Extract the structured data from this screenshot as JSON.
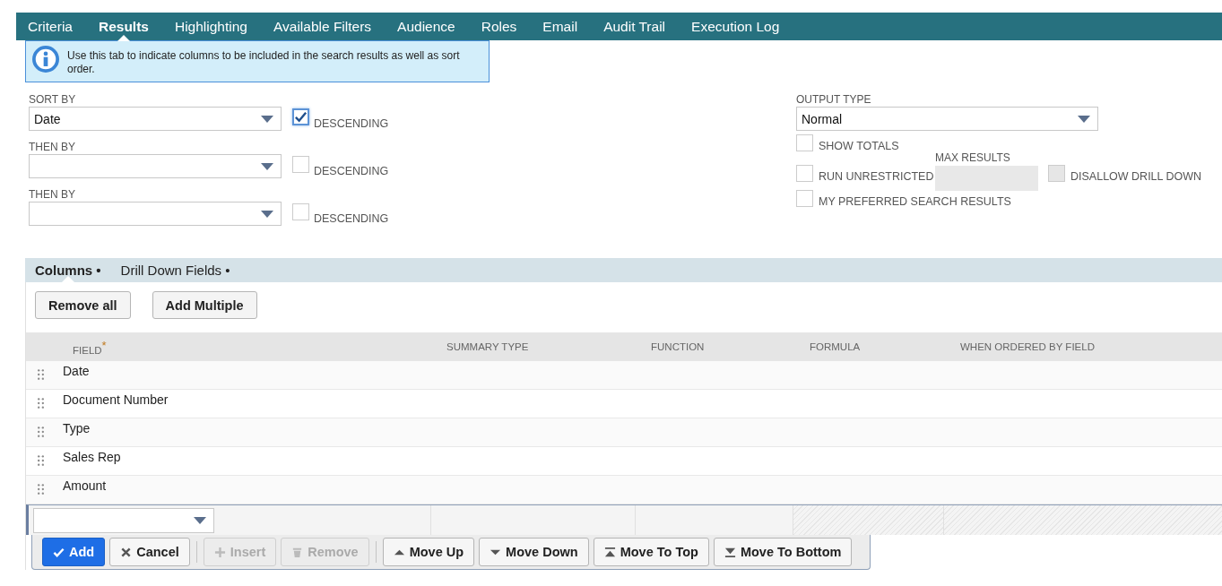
{
  "tabs": [
    {
      "label": "Criteria",
      "selected": false
    },
    {
      "label": "Results",
      "selected": true
    },
    {
      "label": "Highlighting",
      "selected": false
    },
    {
      "label": "Available Filters",
      "selected": false
    },
    {
      "label": "Audience",
      "selected": false
    },
    {
      "label": "Roles",
      "selected": false
    },
    {
      "label": "Email",
      "selected": false
    },
    {
      "label": "Audit Trail",
      "selected": false
    },
    {
      "label": "Execution Log",
      "selected": false
    }
  ],
  "info": {
    "text": "Use this tab to indicate columns to be included in the search results as well as sort order."
  },
  "sort": [
    {
      "label": "SORT BY",
      "value": "Date",
      "descending_label": "DESCENDING",
      "checked": true
    },
    {
      "label": "THEN BY",
      "descending_label": "DESCENDING",
      "checked": false
    },
    {
      "label": "THEN BY",
      "descending_label": "DESCENDING",
      "checked": false
    }
  ],
  "output_type": {
    "label": "OUTPUT TYPE",
    "value": "Normal"
  },
  "show_totals": {
    "label": "SHOW TOTALS",
    "checked": false
  },
  "max_results": {
    "label": "MAX RESULTS",
    "disabled": true
  },
  "run_unrestricted": {
    "label": "RUN UNRESTRICTED",
    "checked": false
  },
  "disallow_drill_down": {
    "label": "DISALLOW DRILL DOWN",
    "checked": false,
    "disabled": true
  },
  "my_preferred": {
    "label": "MY PREFERRED SEARCH RESULTS",
    "checked": false
  },
  "subtabs": [
    {
      "label": "Columns •",
      "selected": true
    },
    {
      "label": "Drill Down Fields •",
      "selected": false
    }
  ],
  "column_buttons": [
    "Remove all",
    "Add Multiple"
  ],
  "table": {
    "columns": [
      {
        "label": "FIELD",
        "required_mark": "*"
      },
      {
        "label": "SUMMARY TYPE"
      },
      {
        "label": "FUNCTION"
      },
      {
        "label": "FORMULA"
      },
      {
        "label": "WHEN ORDERED BY FIELD"
      }
    ],
    "rows": [
      {
        "field": "Date"
      },
      {
        "field": "Document Number"
      },
      {
        "field": "Type"
      },
      {
        "field": "Sales Rep"
      },
      {
        "field": "Amount"
      }
    ]
  },
  "toolbar": [
    {
      "label": "Add",
      "kind": "add",
      "disabled": false
    },
    {
      "label": "Cancel",
      "kind": "cancel",
      "disabled": false
    },
    {
      "label": "Insert",
      "kind": "insert",
      "disabled": true
    },
    {
      "label": "Remove",
      "kind": "remove",
      "disabled": true
    },
    {
      "label": "Move Up",
      "kind": "move_up",
      "disabled": false
    },
    {
      "label": "Move Down",
      "kind": "move_down",
      "disabled": false
    },
    {
      "label": "Move To Top",
      "kind": "move_top",
      "disabled": false
    },
    {
      "label": "Move To Bottom",
      "kind": "move_bottom",
      "disabled": false
    }
  ]
}
